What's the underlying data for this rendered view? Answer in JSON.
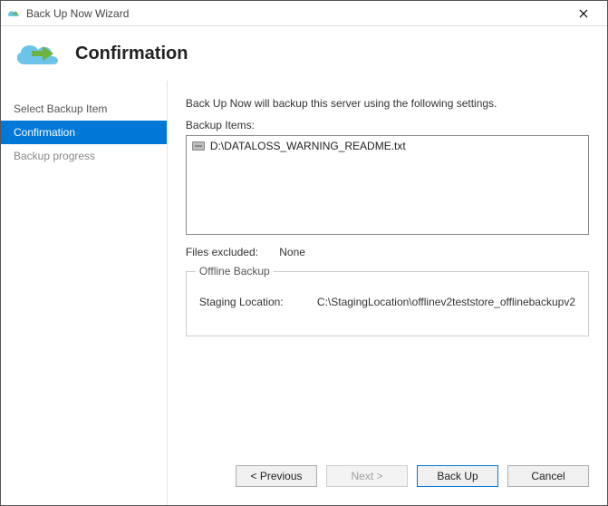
{
  "window": {
    "title": "Back Up Now Wizard"
  },
  "header": {
    "page_title": "Confirmation"
  },
  "sidebar": {
    "items": [
      {
        "label": "Select Backup Item"
      },
      {
        "label": "Confirmation"
      },
      {
        "label": "Backup progress"
      }
    ]
  },
  "content": {
    "intro": "Back Up Now will backup this server using the following settings.",
    "backup_items_label": "Backup Items:",
    "backup_items": [
      "D:\\DATALOSS_WARNING_README.txt"
    ],
    "files_excluded_label": "Files excluded:",
    "files_excluded_value": "None",
    "offline_backup": {
      "legend": "Offline Backup",
      "staging_label": "Staging Location:",
      "staging_value": "C:\\StagingLocation\\offlinev2teststore_offlinebackupv2"
    }
  },
  "buttons": {
    "previous": "< Previous",
    "next": "Next >",
    "backup": "Back Up",
    "cancel": "Cancel"
  }
}
